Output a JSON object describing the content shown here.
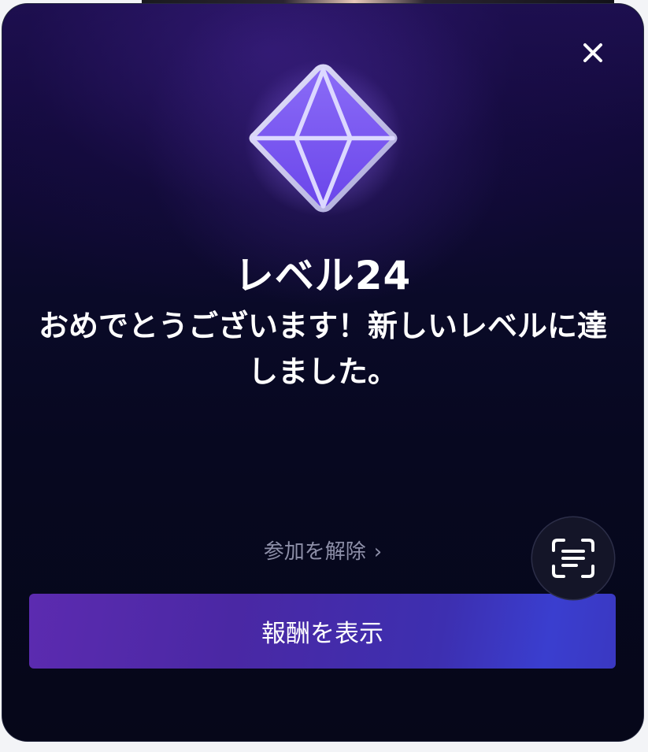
{
  "modal": {
    "close_icon": "close-icon",
    "gem_icon": "diamond-gem-icon",
    "level_title": "レベル24",
    "message": "おめでとうございます！新しいレベルに達しました。",
    "unsubscribe_label": "参加を解除",
    "unsubscribe_chevron": "›",
    "scan_icon": "text-scan-icon",
    "reward_button_label": "報酬を表示"
  },
  "colors": {
    "background": "#070820",
    "accent_purple": "#5c2bb0",
    "accent_blue": "#3a3ecf",
    "gem": "#7c5cf0",
    "muted_text": "#8d8fa8"
  }
}
